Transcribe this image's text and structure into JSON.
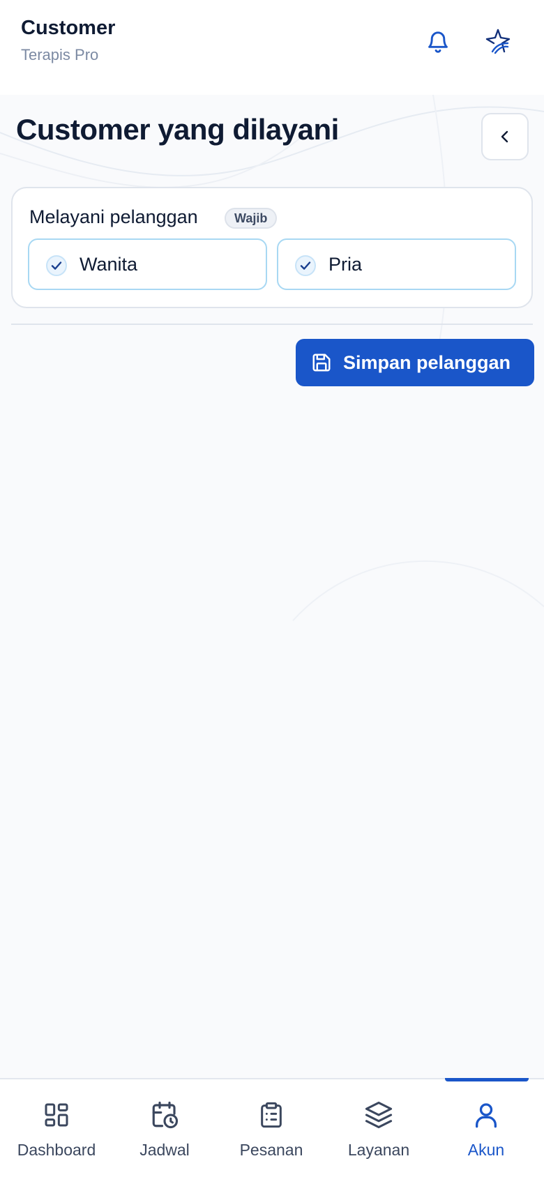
{
  "header": {
    "title": "Customer",
    "subtitle": "Terapis Pro",
    "icons": [
      "bell-icon",
      "brand-logo-icon"
    ]
  },
  "page": {
    "title": "Customer yang dilayani",
    "back_icon": "chevron-left-icon"
  },
  "serve_card": {
    "label": "Melayani pelanggan",
    "badge": "Wajib",
    "options": [
      {
        "label": "Wanita",
        "checked": true
      },
      {
        "label": "Pria",
        "checked": true
      }
    ]
  },
  "save_button": {
    "label": "Simpan pelanggan",
    "icon": "save-icon"
  },
  "bottom_nav": {
    "items": [
      {
        "label": "Dashboard",
        "icon": "dashboard-icon",
        "active": false
      },
      {
        "label": "Jadwal",
        "icon": "calendar-clock-icon",
        "active": false
      },
      {
        "label": "Pesanan",
        "icon": "clipboard-list-icon",
        "active": false
      },
      {
        "label": "Layanan",
        "icon": "layers-icon",
        "active": false
      },
      {
        "label": "Akun",
        "icon": "user-icon",
        "active": true
      }
    ]
  },
  "colors": {
    "primary": "#1a56c9",
    "text_dark": "#0f1b33",
    "text_muted": "#7c8aa3",
    "option_border": "#a8d8f3",
    "background": "#f9fafc"
  }
}
